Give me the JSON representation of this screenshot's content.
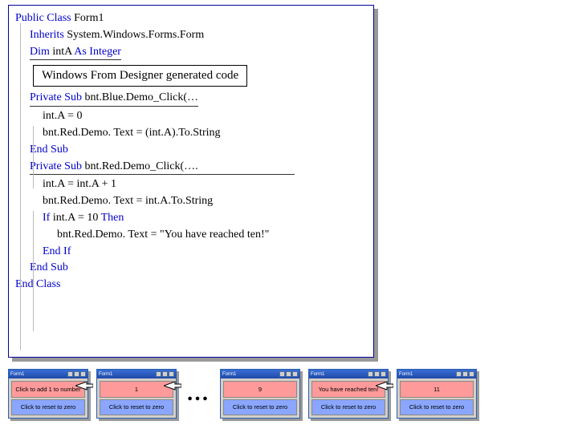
{
  "code": {
    "l1_kw": "Public Class",
    "l1_rest": " Form1",
    "l2_kw": "Inherits",
    "l2_rest": " System.Windows.Forms.Form",
    "l3_kw1": "Dim",
    "l3_mid": " intA ",
    "l3_kw2": "As Integer",
    "region": "Windows From Designer generated code",
    "l4_kw": "Private Sub",
    "l4_rest": " bnt.Blue.Demo_Click(…",
    "l5": "int.A = 0",
    "l6": "bnt.Red.Demo. Text = (int.A).To.String",
    "l7": "End Sub",
    "l8_kw": "Private Sub",
    "l8_rest": " bnt.Red.Demo_Click(….",
    "l9": "int.A = int.A + 1",
    "l10": "bnt.Red.Demo. Text = int.A.To.String",
    "l11_kw1": "If",
    "l11_mid": " int.A = 10 ",
    "l11_kw2": "Then",
    "l12": "bnt.Red.Demo. Text = \"You have reached ten!\"",
    "l13": "End If",
    "l14": "End Sub",
    "l15": "End Class"
  },
  "thumbs": {
    "win_title": "Form1",
    "blue_label": "Click to reset to zero",
    "red_default": "Click to add 1 to number",
    "t2_red": "1",
    "t3_red": "9",
    "t4_red": "You have reached ten!",
    "t5_red": "11",
    "ellipsis": "…"
  }
}
